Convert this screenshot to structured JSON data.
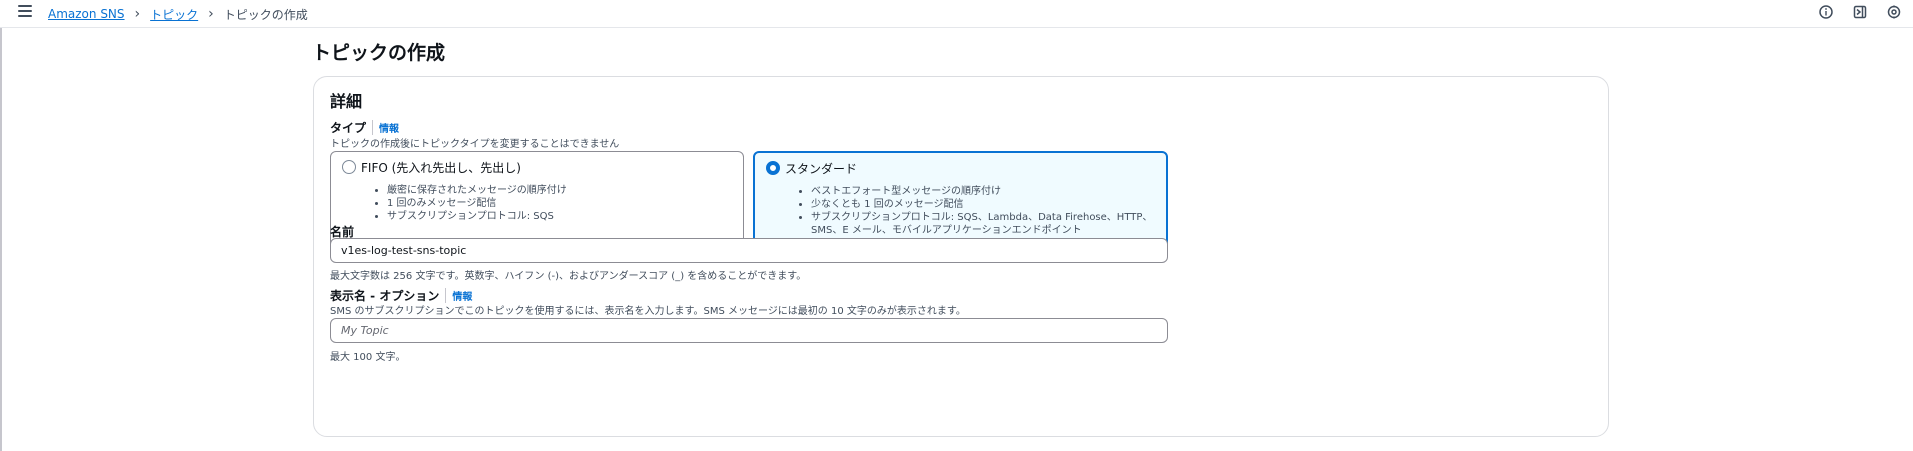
{
  "breadcrumb": {
    "items": [
      {
        "label": "Amazon SNS"
      },
      {
        "label": "トピック"
      }
    ],
    "current": "トピックの作成"
  },
  "icons": {
    "menu": "hamburger-menu-icon",
    "info": "info-icon",
    "panel": "panel-icon",
    "settings": "settings-icon"
  },
  "page": {
    "title": "トピックの作成"
  },
  "details": {
    "title": "詳細",
    "type": {
      "label": "タイプ",
      "info": "情報",
      "description": "トピックの作成後にトピックタイプを変更することはできません",
      "options": [
        {
          "title": "FIFO (先入れ先出し、先出し)",
          "selected": false,
          "bullets": [
            "厳密に保存されたメッセージの順序付け",
            "1 回のみメッセージ配信",
            "サブスクリプションプロトコル: SQS"
          ]
        },
        {
          "title": "スタンダード",
          "selected": true,
          "bullets": [
            "ベストエフォート型メッセージの順序付け",
            "少なくとも 1 回のメッセージ配信",
            "サブスクリプションプロトコル: SQS、Lambda、Data Firehose、HTTP、",
            "SMS、E メール、モバイルアプリケーションエンドポイント"
          ]
        }
      ]
    },
    "name": {
      "label": "名前",
      "value": "v1es-log-test-sns-topic",
      "constraint": "最大文字数は 256 文字です。英数字、ハイフン (-)、およびアンダースコア (_) を含めることができます。"
    },
    "display_name": {
      "label": "表示名 - オプション",
      "info": "情報",
      "description": "SMS のサブスクリプションでこのトピックを使用するには、表示名を入力します。SMS メッセージには最初の 10 文字のみが表示されます。",
      "placeholder": "My Topic",
      "constraint": "最大 100 文字。"
    }
  },
  "colors": {
    "link": "#0972d3",
    "selected_tile_bg": "#f0fbff",
    "text": "#0f141a",
    "secondary_text": "#414d5c"
  }
}
